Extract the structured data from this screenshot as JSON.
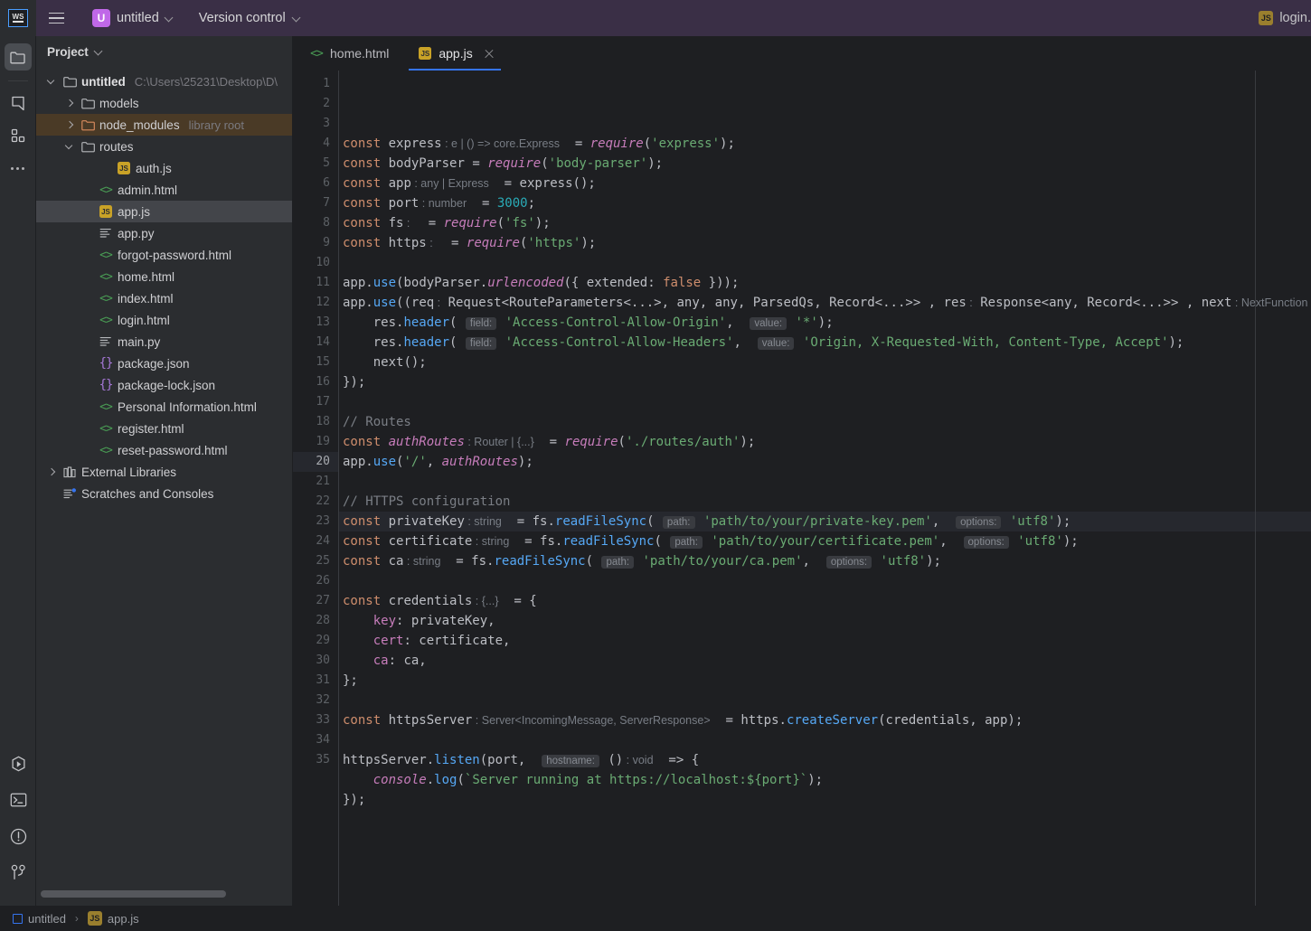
{
  "titlebar": {
    "logo": "ws-logo",
    "menu_icon": "hamburger-menu-icon",
    "project_badge": "U",
    "project_name": "untitled",
    "vcs_label": "Version control",
    "right_file_badge": "JS",
    "right_file_label": "login."
  },
  "rail": {
    "top": [
      {
        "name": "project-tool-window",
        "icon": "folder-icon",
        "active": true
      },
      {
        "name": "bookmarks-tool-window",
        "icon": "bookmark-icon",
        "active": false
      },
      {
        "name": "structure-tool-window",
        "icon": "structure-icon",
        "active": false
      },
      {
        "name": "more-tool-windows",
        "icon": "more-dots-icon",
        "active": false
      }
    ],
    "bottom": [
      {
        "name": "run-tool-window",
        "icon": "run-icon"
      },
      {
        "name": "terminal-tool-window",
        "icon": "terminal-icon"
      },
      {
        "name": "problems-tool-window",
        "icon": "warning-circle-icon"
      },
      {
        "name": "version-control-tool-window",
        "icon": "branch-icon"
      }
    ]
  },
  "project_panel": {
    "title": "Project",
    "tree": [
      {
        "indent": 0,
        "arrow": "expanded",
        "icon": "folder-icon",
        "label": "untitled",
        "bold": true,
        "sub": "C:\\Users\\25231\\Desktop\\D\\",
        "state": "normal"
      },
      {
        "indent": 1,
        "arrow": "collapsed",
        "icon": "folder-icon",
        "label": "models",
        "sub": "",
        "state": "normal"
      },
      {
        "indent": 1,
        "arrow": "collapsed",
        "icon": "folder-orange-icon",
        "label": "node_modules",
        "sub": "library root",
        "state": "highlight"
      },
      {
        "indent": 1,
        "arrow": "expanded",
        "icon": "folder-icon",
        "label": "routes",
        "sub": "",
        "state": "normal"
      },
      {
        "indent": 3,
        "arrow": "none",
        "icon": "js-file-icon",
        "label": "auth.js",
        "sub": "",
        "state": "normal"
      },
      {
        "indent": 2,
        "arrow": "none",
        "icon": "html-file-icon",
        "label": "admin.html",
        "sub": "",
        "state": "normal"
      },
      {
        "indent": 2,
        "arrow": "none",
        "icon": "js-file-icon",
        "label": "app.js",
        "sub": "",
        "state": "selected"
      },
      {
        "indent": 2,
        "arrow": "none",
        "icon": "python-file-icon",
        "label": "app.py",
        "sub": "",
        "state": "normal"
      },
      {
        "indent": 2,
        "arrow": "none",
        "icon": "html-file-icon",
        "label": "forgot-password.html",
        "sub": "",
        "state": "normal"
      },
      {
        "indent": 2,
        "arrow": "none",
        "icon": "html-file-icon",
        "label": "home.html",
        "sub": "",
        "state": "normal"
      },
      {
        "indent": 2,
        "arrow": "none",
        "icon": "html-file-icon",
        "label": "index.html",
        "sub": "",
        "state": "normal"
      },
      {
        "indent": 2,
        "arrow": "none",
        "icon": "html-file-icon",
        "label": "login.html",
        "sub": "",
        "state": "normal"
      },
      {
        "indent": 2,
        "arrow": "none",
        "icon": "python-file-icon",
        "label": "main.py",
        "sub": "",
        "state": "normal"
      },
      {
        "indent": 2,
        "arrow": "none",
        "icon": "json-file-icon",
        "label": "package.json",
        "sub": "",
        "state": "normal"
      },
      {
        "indent": 2,
        "arrow": "none",
        "icon": "json-file-icon",
        "label": "package-lock.json",
        "sub": "",
        "state": "normal"
      },
      {
        "indent": 2,
        "arrow": "none",
        "icon": "html-file-icon",
        "label": "Personal Information.html",
        "sub": "",
        "state": "normal"
      },
      {
        "indent": 2,
        "arrow": "none",
        "icon": "html-file-icon",
        "label": "register.html",
        "sub": "",
        "state": "normal"
      },
      {
        "indent": 2,
        "arrow": "none",
        "icon": "html-file-icon",
        "label": "reset-password.html",
        "sub": "",
        "state": "normal"
      },
      {
        "indent": 0,
        "arrow": "collapsed",
        "icon": "library-icon",
        "label": "External Libraries",
        "sub": "",
        "state": "normal"
      },
      {
        "indent": 0,
        "arrow": "none",
        "icon": "scratches-icon",
        "label": "Scratches and Consoles",
        "sub": "",
        "state": "normal"
      }
    ]
  },
  "editor": {
    "tabs": [
      {
        "label": "home.html",
        "icon": "html-file-icon",
        "active": false,
        "closable": false
      },
      {
        "label": "app.js",
        "icon": "js-file-icon",
        "active": true,
        "closable": true
      }
    ],
    "current_line": 20,
    "total_lines": 35,
    "line_numbers": [
      1,
      2,
      3,
      4,
      5,
      6,
      7,
      8,
      9,
      10,
      11,
      12,
      13,
      14,
      15,
      16,
      17,
      18,
      19,
      20,
      21,
      22,
      23,
      24,
      25,
      26,
      27,
      28,
      29,
      30,
      31,
      32,
      33,
      34,
      35
    ],
    "code_lines": [
      "const express : e | () => core.Express  = require('express');",
      "const bodyParser = require('body-parser');",
      "const app : any | Express  = express();",
      "const port : number  = 3000;",
      "const fs :   = require('fs');",
      "const https :   = require('https');",
      "",
      "app.use(bodyParser.urlencoded({ extended: false }));",
      "app.use((req : Request<RouteParameters<...>, any, any, ParsedQs, Record<...>> , res : Response<any, Record<...>> , next : NextFunction ) : void  => {",
      "    res.header( field: 'Access-Control-Allow-Origin',  value: '*');",
      "    res.header( field: 'Access-Control-Allow-Headers',  value: 'Origin, X-Requested-With, Content-Type, Accept');",
      "    next();",
      "});",
      "",
      "// Routes",
      "const authRoutes : Router | {...}  = require('./routes/auth');",
      "app.use('/', authRoutes);",
      "",
      "// HTTPS configuration",
      "const privateKey : string  = fs.readFileSync( path: 'path/to/your/private-key.pem',  options: 'utf8');",
      "const certificate : string  = fs.readFileSync( path: 'path/to/your/certificate.pem',  options: 'utf8');",
      "const ca : string  = fs.readFileSync( path: 'path/to/your/ca.pem',  options: 'utf8');",
      "",
      "const credentials : {...}  = {",
      "    key: privateKey,",
      "    cert: certificate,",
      "    ca: ca,",
      "};",
      "",
      "const httpsServer : Server<IncomingMessage, ServerResponse>  = https.createServer(credentials, app);",
      "",
      "httpsServer.listen(port,  hostname: () : void  => {",
      "    console.log(`Server running at https://localhost:${port}`);",
      "});",
      ""
    ]
  },
  "statusbar": {
    "project_label": "untitled",
    "separator": "›",
    "file_badge": "JS",
    "file_label": "app.js"
  },
  "colors": {
    "titlebar_bg": "#3a2f46",
    "panel_bg": "#2b2d30",
    "editor_bg": "#1e1f22",
    "accent": "#3574f0",
    "badge_purple": "#c068e8",
    "js_yellow": "#9a7f2e",
    "highlight_row": "#4a3a26",
    "selected_row": "#43454a",
    "keyword": "#cf8e6d",
    "string": "#6aab73",
    "number": "#2aacb8",
    "comment": "#7a7e85",
    "function": "#56a8f5",
    "italic_ident": "#c77dbb",
    "hint": "#787d85"
  }
}
